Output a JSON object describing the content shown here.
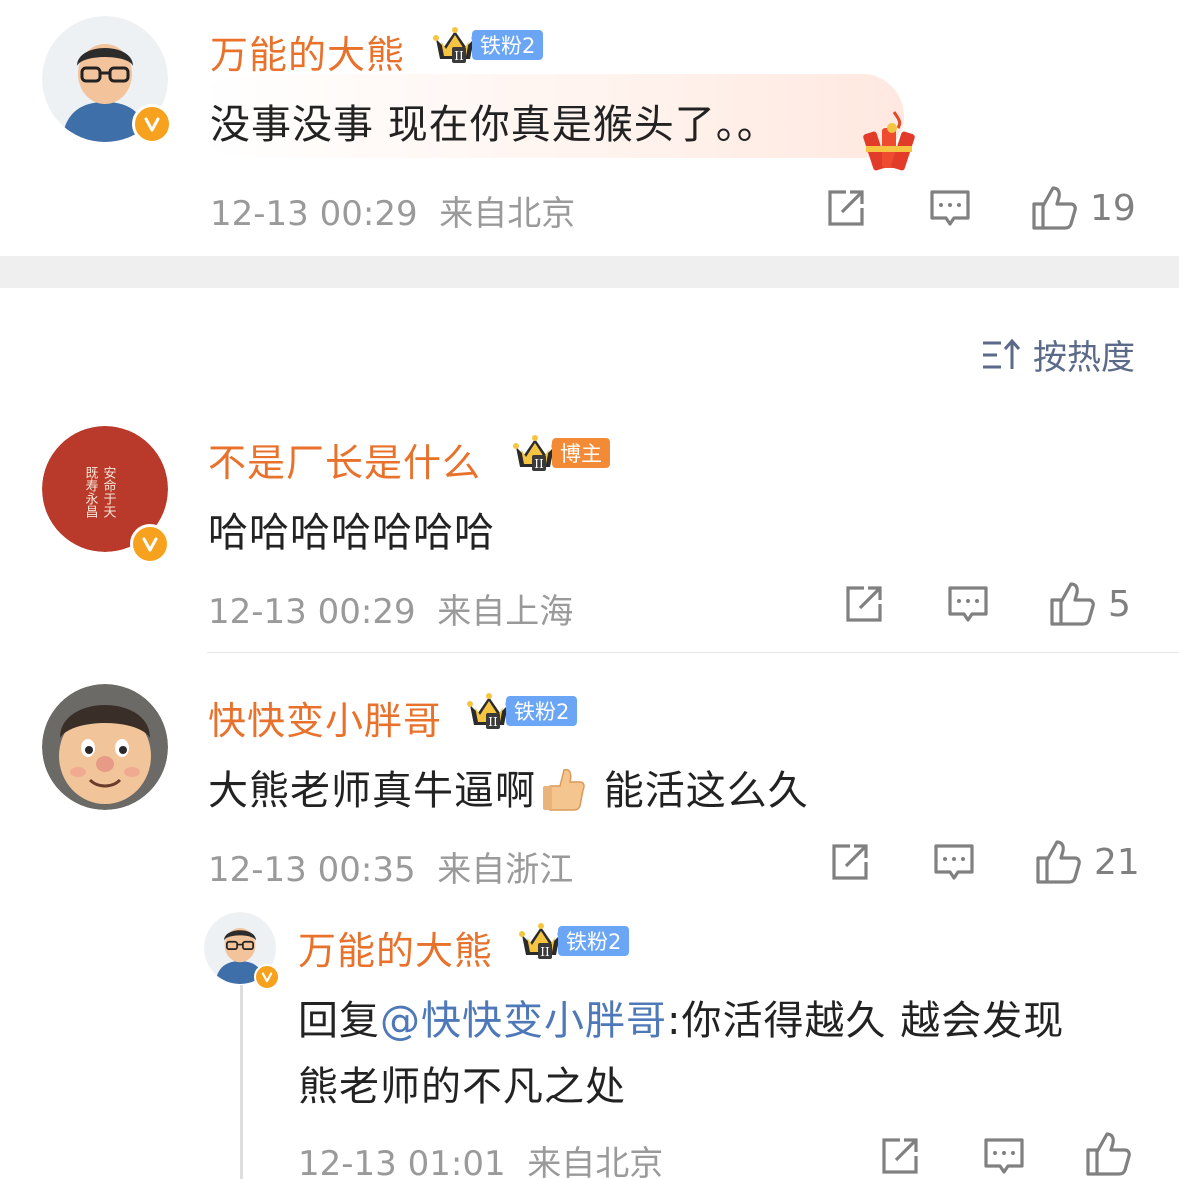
{
  "comments": [
    {
      "name": "万能的大熊",
      "badge": "铁粉2",
      "text": "没事没事 现在你真是猴头了。。",
      "time": "12-13 00:29",
      "location": "来自北京",
      "likes": "19"
    },
    {
      "name": "不是厂长是什么",
      "badge": "博主",
      "avatar_text": "安命于天 既寿永昌",
      "text": "哈哈哈哈哈哈哈",
      "time": "12-13 00:29",
      "location": "来自上海",
      "likes": "5"
    },
    {
      "name": "快快变小胖哥",
      "badge": "铁粉2",
      "text_before": "大熊老师真牛逼啊",
      "text_after": " 能活这么久",
      "time": "12-13 00:35",
      "location": "来自浙江",
      "likes": "21"
    }
  ],
  "reply": {
    "name": "万能的大熊",
    "badge": "铁粉2",
    "prefix": "回复",
    "mention": "@快快变小胖哥",
    "line1": ":你活得越久 越会发现",
    "line2": "熊老师的不凡之处",
    "time": "12-13 01:01",
    "location": "来自北京"
  },
  "sort_label": "按热度",
  "icons": {
    "share": "share-icon",
    "comment": "comment-icon",
    "like": "thumbs-up-icon",
    "sort": "sort-icon",
    "verified": "verified-v-icon",
    "crown": "crown-icon",
    "firecracker": "firecracker-icon",
    "thumbs_emoji": "thumbs-up-emoji"
  },
  "colors": {
    "name": "#e8712b",
    "fan_badge": "#6aa6f5",
    "blogger_badge": "#f38a35",
    "mention": "#4e78b8",
    "verified": "#f6a21e"
  }
}
